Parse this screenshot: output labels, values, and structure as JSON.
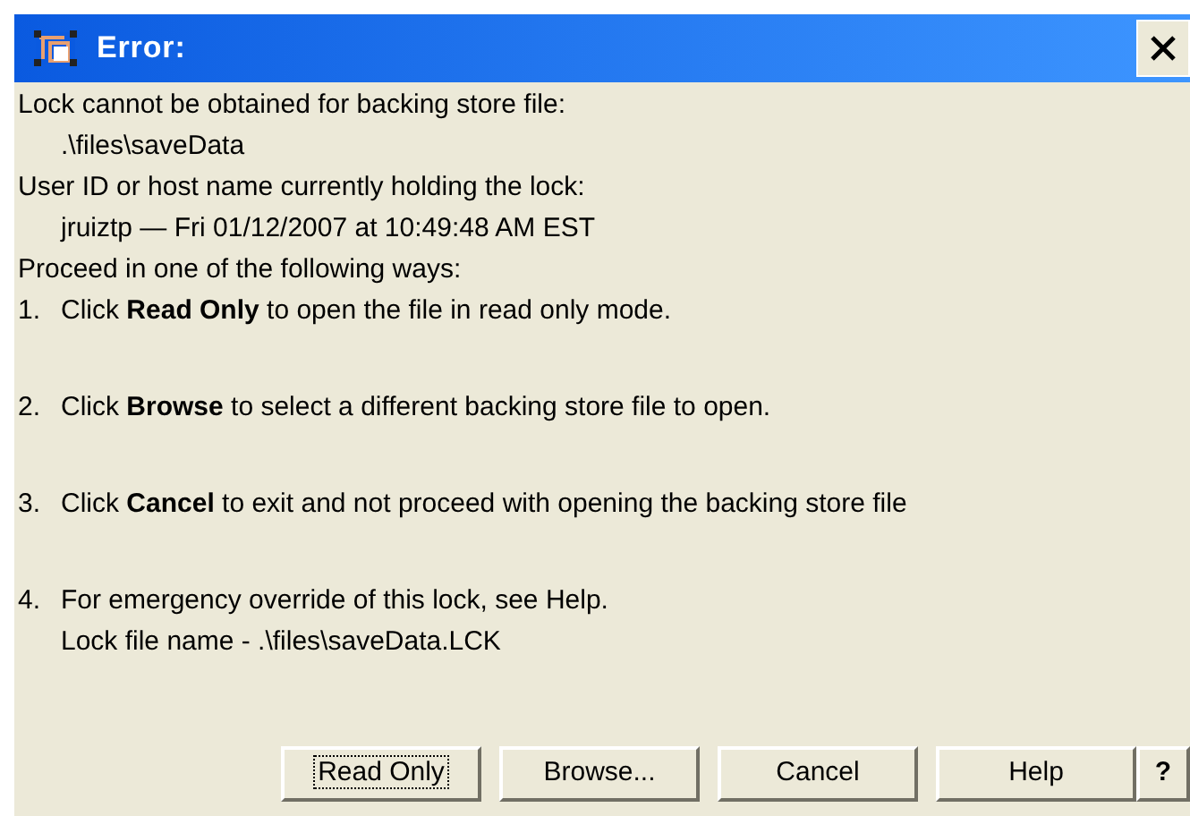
{
  "window": {
    "title": "Error:"
  },
  "message": {
    "intro": "Lock cannot be obtained for backing store file:",
    "file": ".\\files\\saveData",
    "holder_label": "User ID or host name currently holding the lock:",
    "holder": "jruiztp — Fri 01/12/2007 at 10:49:48 AM EST",
    "proceed": "Proceed in one of the following ways:"
  },
  "steps": [
    {
      "number": "1.",
      "text": "Click **Read Only** to open the file in read only mode."
    },
    {
      "number": "2.",
      "text": "Click **Browse** to select a different backing store file to open."
    },
    {
      "number": "3.",
      "text": "Click **Cancel** to exit and not proceed with opening the backing store file"
    },
    {
      "number": "4.",
      "text": "For emergency override of this lock, see Help.",
      "note": "Lock file name - .\\files\\saveData.LCK"
    }
  ],
  "buttons": [
    {
      "label": "Read Only",
      "focused": true
    },
    {
      "label": "Browse...",
      "focused": false
    },
    {
      "label": "Cancel",
      "focused": false
    },
    {
      "label": "Help",
      "focused": false
    },
    {
      "label": "?",
      "focused": false
    }
  ]
}
